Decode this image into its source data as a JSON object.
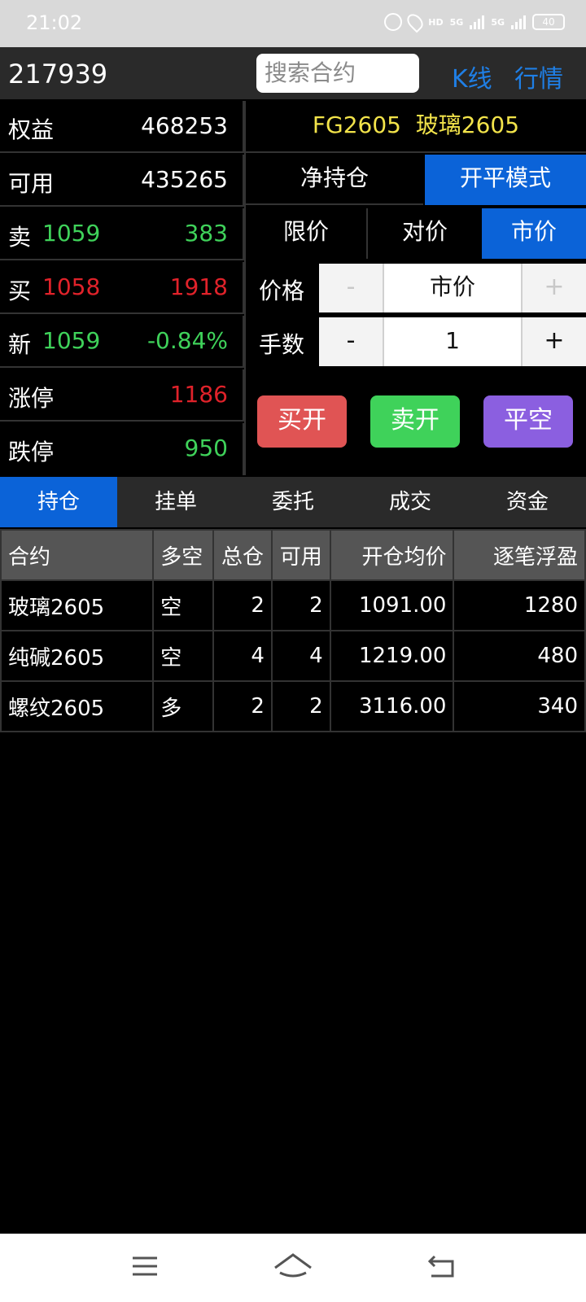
{
  "status": {
    "time": "21:02",
    "hd": "HD",
    "net1": "5G",
    "net2": "5G",
    "battery": "40"
  },
  "header": {
    "account": "217939",
    "search_placeholder": "搜索合约",
    "kline": "K线",
    "quote": "行情"
  },
  "info": {
    "equity_label": "权益",
    "equity": "468253",
    "avail_label": "可用",
    "avail": "435265",
    "sell_label": "卖",
    "sell_price": "1059",
    "sell_vol": "383",
    "buy_label": "买",
    "buy_price": "1058",
    "buy_vol": "1918",
    "last_label": "新",
    "last_price": "1059",
    "change": "-0.84%",
    "limit_up_label": "涨停",
    "limit_up": "1186",
    "limit_down_label": "跌停",
    "limit_down": "950"
  },
  "contract": {
    "code": "FG2605",
    "name": "玻璃2605"
  },
  "mode": {
    "net": "净持仓",
    "open_close": "开平模式",
    "active": "open_close"
  },
  "price_type": {
    "limit": "限价",
    "counter": "对价",
    "market": "市价",
    "active": "market"
  },
  "order": {
    "price_label": "价格",
    "price_value": "市价",
    "minus": "-",
    "plus": "+",
    "qty_label": "手数",
    "qty_value": "1"
  },
  "actions": {
    "buy_open": "买开",
    "sell_open": "卖开",
    "close_short": "平空",
    "colors": {
      "buy_open": "#e05454",
      "sell_open": "#3fd25a",
      "close_short": "#8b5fe0"
    }
  },
  "tabs": [
    {
      "label": "持仓",
      "active": true
    },
    {
      "label": "挂单",
      "active": false
    },
    {
      "label": "委托",
      "active": false
    },
    {
      "label": "成交",
      "active": false
    },
    {
      "label": "资金",
      "active": false
    }
  ],
  "positions": {
    "headers": [
      "合约",
      "多空",
      "总仓",
      "可用",
      "开仓均价",
      "逐笔浮盈"
    ],
    "rows": [
      {
        "contract": "玻璃2605",
        "dir": "空",
        "total": "2",
        "avail": "2",
        "avg": "1091.00",
        "pnl": "1280"
      },
      {
        "contract": "纯碱2605",
        "dir": "空",
        "total": "4",
        "avail": "4",
        "avg": "1219.00",
        "pnl": "480"
      },
      {
        "contract": "螺纹2605",
        "dir": "多",
        "total": "2",
        "avail": "2",
        "avg": "3116.00",
        "pnl": "340"
      }
    ]
  },
  "colors": {
    "accent": "#0b63d8",
    "up": "#e0222a",
    "down": "#3fd25a",
    "contract": "#f2e34a"
  }
}
